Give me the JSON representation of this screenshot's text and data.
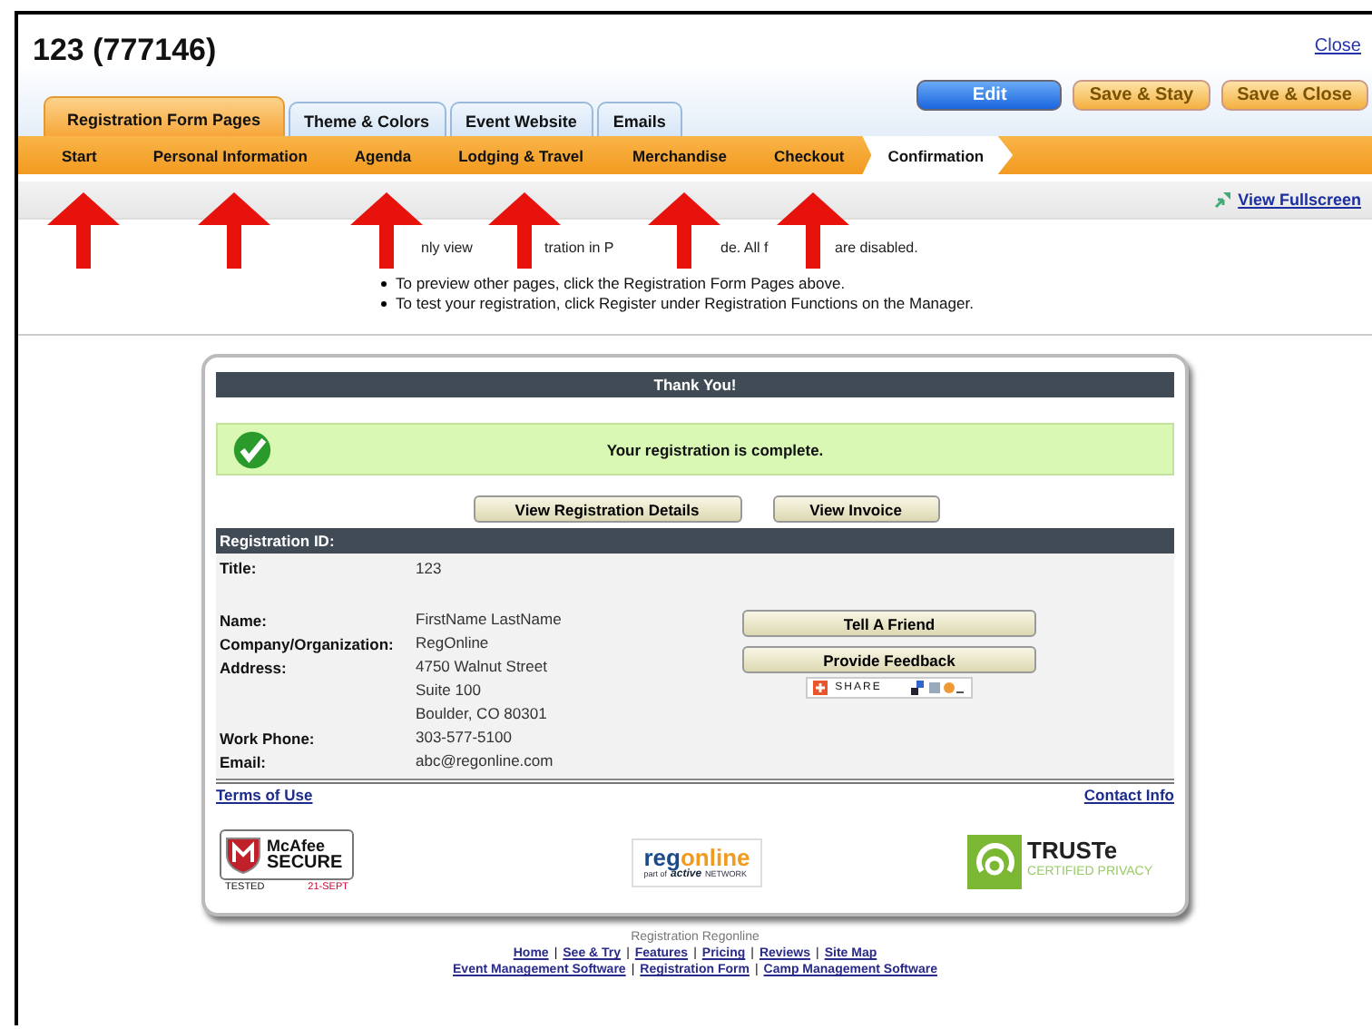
{
  "page": {
    "title": "123 (777146)",
    "close": "Close"
  },
  "actions": [
    {
      "label": "Edit",
      "kind": "primary"
    },
    {
      "label": "Save & Stay",
      "kind": "secondary"
    },
    {
      "label": "Save & Close",
      "kind": "secondary"
    }
  ],
  "tabs": [
    {
      "label": "Registration Form Pages",
      "selected": true
    },
    {
      "label": "Theme & Colors",
      "selected": false
    },
    {
      "label": "Event Website",
      "selected": false
    },
    {
      "label": "Emails",
      "selected": false
    }
  ],
  "steps": [
    {
      "label": "Start",
      "selected": false,
      "marked": true
    },
    {
      "label": "Personal Information",
      "selected": false,
      "marked": true
    },
    {
      "label": "Agenda",
      "selected": false,
      "marked": true
    },
    {
      "label": "Lodging & Travel",
      "selected": false,
      "marked": true
    },
    {
      "label": "Merchandise",
      "selected": false,
      "marked": true
    },
    {
      "label": "Checkout",
      "selected": false,
      "marked": true
    },
    {
      "label": "Confirmation",
      "selected": true,
      "marked": false
    }
  ],
  "toolbar": {
    "fullscreen": "View Fullscreen"
  },
  "notice": {
    "fragments": [
      "nly view",
      "tration in P",
      "de. All f",
      "are disabled."
    ],
    "bullets": [
      "To preview other pages, click the Registration Form Pages above.",
      "To test your registration, click Register under Registration Functions on the Manager."
    ]
  },
  "card": {
    "header": "Thank You!",
    "success": "Your registration is complete.",
    "buttons": [
      "View Registration Details",
      "View Invoice"
    ],
    "section": "Registration ID:",
    "title_field": {
      "label": "Title:",
      "value": "123"
    },
    "fields": [
      {
        "label": "Name:",
        "lines": [
          "FirstName LastName"
        ]
      },
      {
        "label": "Company/Organization:",
        "lines": [
          "RegOnline"
        ]
      },
      {
        "label": "Address:",
        "lines": [
          "4750 Walnut Street",
          "Suite 100",
          "Boulder, CO 80301"
        ]
      },
      {
        "label": "Work Phone:",
        "lines": [
          "303-577-5100"
        ]
      },
      {
        "label": "Email:",
        "lines": [
          "abc@regonline.com"
        ]
      }
    ],
    "side_buttons": [
      "Tell A Friend",
      "Provide Feedback"
    ],
    "share": "SHARE",
    "links": [
      "Terms of Use",
      "Contact Info"
    ],
    "mcafee": {
      "name": "McAfee",
      "secure": "SECURE",
      "tested": "TESTED",
      "date": "21-SEPT"
    },
    "regonline": {
      "reg": "reg",
      "online": "online",
      "part": "part of",
      "active": "active",
      "network": "NETWORK"
    },
    "truste": {
      "name": "TRUSTe",
      "sub": "CERTIFIED PRIVACY"
    }
  },
  "footer": {
    "caption": "Registration Regonline",
    "links": [
      [
        {
          "kind": "link",
          "text": "Home"
        },
        {
          "kind": "separator",
          "text": "|"
        },
        {
          "kind": "link",
          "text": "See & Try"
        },
        {
          "kind": "separator",
          "text": "|"
        },
        {
          "kind": "link",
          "text": "Features"
        },
        {
          "kind": "separator",
          "text": "|"
        },
        {
          "kind": "link",
          "text": "Pricing"
        },
        {
          "kind": "separator",
          "text": "|"
        },
        {
          "kind": "link",
          "text": "Reviews"
        },
        {
          "kind": "separator",
          "text": "|"
        },
        {
          "kind": "link",
          "text": "Site Map"
        }
      ],
      [
        {
          "kind": "link",
          "text": "Event Management Software"
        },
        {
          "kind": "separator",
          "text": "|"
        },
        {
          "kind": "link",
          "text": "Registration Form"
        },
        {
          "kind": "separator",
          "text": "|"
        },
        {
          "kind": "link",
          "text": "Camp Management Software"
        }
      ]
    ]
  }
}
